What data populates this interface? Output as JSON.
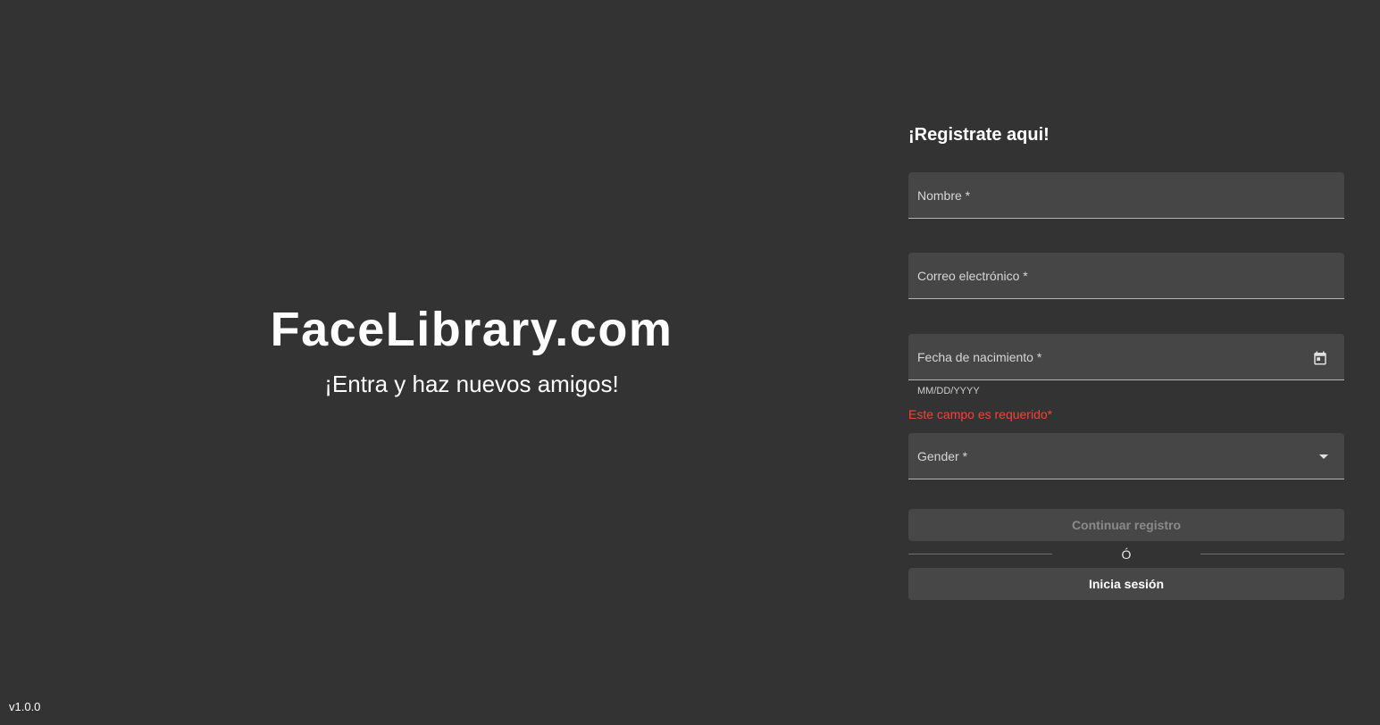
{
  "hero": {
    "brand": "FaceLibrary.com",
    "tagline": "¡Entra y haz nuevos amigos!"
  },
  "form": {
    "title": "¡Registrate aqui!",
    "fields": {
      "name": {
        "label": "Nombre *"
      },
      "email": {
        "label": "Correo electrónico *"
      },
      "birthdate": {
        "label": "Fecha de nacimiento *",
        "hint": "MM/DD/YYYY",
        "error": "Este campo es requerido*",
        "icon": "calendar-icon"
      },
      "gender": {
        "label": "Gender *",
        "icon": "dropdown-arrow-icon"
      }
    },
    "continue_label": "Continuar registro",
    "separator": "Ó",
    "login_label": "Inicia sesión"
  },
  "footer": {
    "version": "v1.0.0"
  },
  "colors": {
    "background": "#333333",
    "field": "#464646",
    "error": "#f44336"
  }
}
